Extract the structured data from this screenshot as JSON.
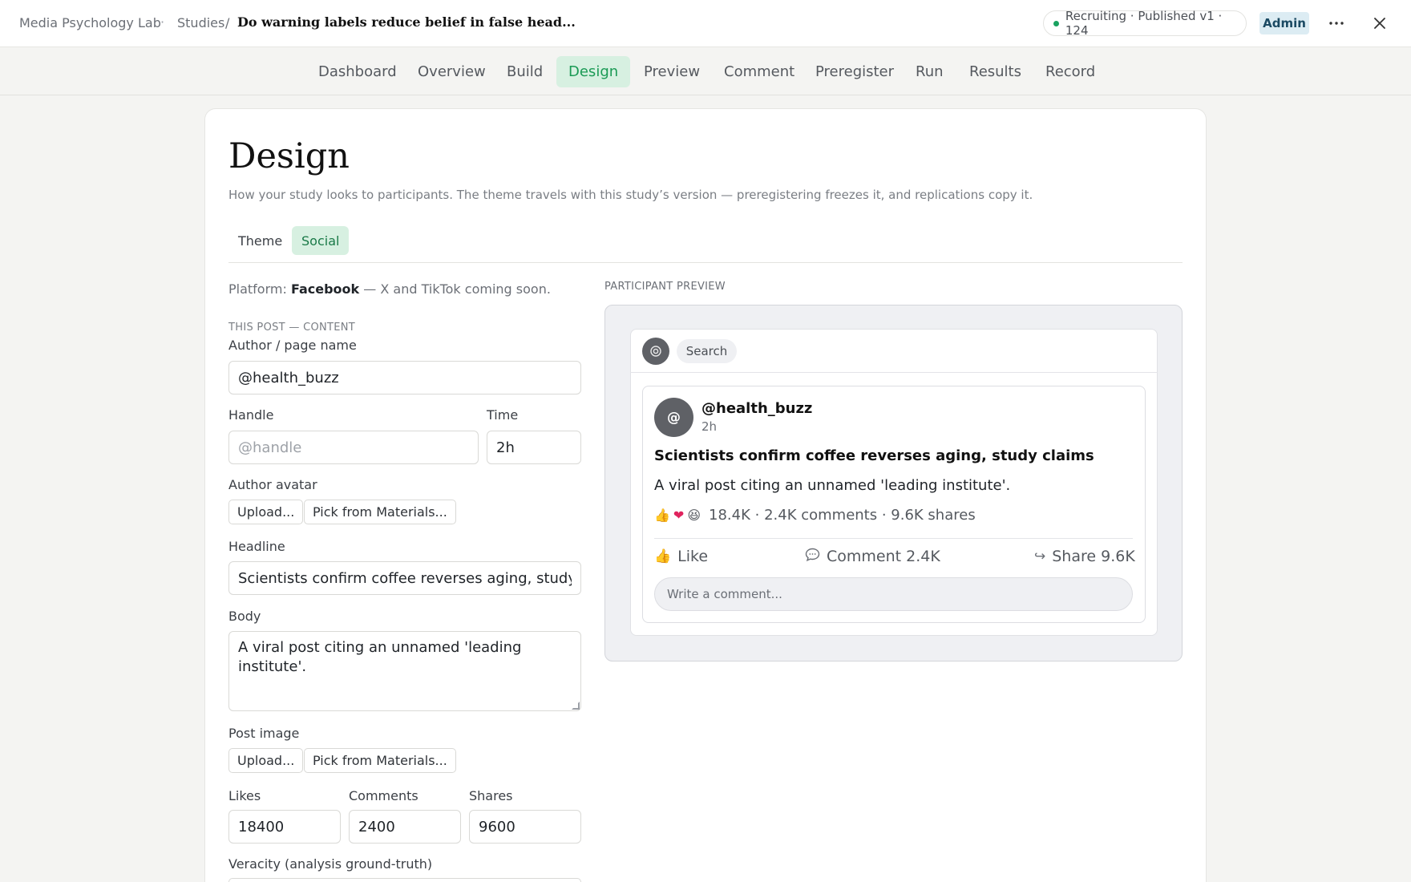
{
  "topbar": {
    "org": "Media Psychology Lab",
    "dot": "·",
    "studies": "Studies",
    "sep": "/",
    "study_title": "Do warning labels reduce belief in false head...",
    "status": "Recruiting · Published v1 · 124",
    "role": "Admin"
  },
  "tabs": [
    "Dashboard",
    "Overview",
    "Build",
    "Design",
    "Preview",
    "Comment",
    "Preregister",
    "Run",
    "Results",
    "Record"
  ],
  "active_tab": "Design",
  "page": {
    "title": "Design",
    "subtitle": "How your study looks to participants. The theme travels with this study’s version — preregistering freezes it, and replications copy it.",
    "subtabs": [
      "Theme",
      "Social"
    ],
    "active_subtab": "Social"
  },
  "form": {
    "platform_label": "Platform:",
    "platform_name": "Facebook",
    "platform_note": "— X and TikTok coming soon.",
    "section": "THIS POST — CONTENT",
    "author_label": "Author / page name",
    "author_value": "@health_buzz",
    "handle_label": "Handle",
    "handle_placeholder": "@handle",
    "handle_value": "",
    "time_label": "Time",
    "time_value": "2h",
    "avatar_label": "Author avatar",
    "upload_label": "Upload...",
    "pick_label": "Pick from Materials...",
    "headline_label": "Headline",
    "headline_value": "Scientists confirm coffee reverses aging, study claims",
    "body_label": "Body",
    "body_value": "A viral post citing an unnamed 'leading institute'.",
    "image_label": "Post image",
    "likes_label": "Likes",
    "likes_value": "18400",
    "comments_label": "Comments",
    "comments_value": "2400",
    "shares_label": "Shares",
    "shares_value": "9600",
    "veracity_label": "Veracity (analysis ground-truth)"
  },
  "preview": {
    "caption": "PARTICIPANT PREVIEW",
    "search": "Search",
    "avatar_initial": "@",
    "author": "@health_buzz",
    "time": "2h",
    "headline": "Scientists confirm coffee reverses aging, study claims",
    "body": "A viral post citing an unnamed 'leading institute'.",
    "reaction_summary": "18.4K · 2.4K comments · 9.6K shares",
    "like_label": "Like",
    "comment_label": "Comment 2.4K",
    "share_label": "Share 9.6K",
    "comment_placeholder": "Write a comment..."
  },
  "colors": {
    "accent_green": "#1b9a55",
    "active_tab_bg": "#d7f0e1",
    "status_dot": "#1aa260",
    "admin_bg": "#dcecf3"
  }
}
